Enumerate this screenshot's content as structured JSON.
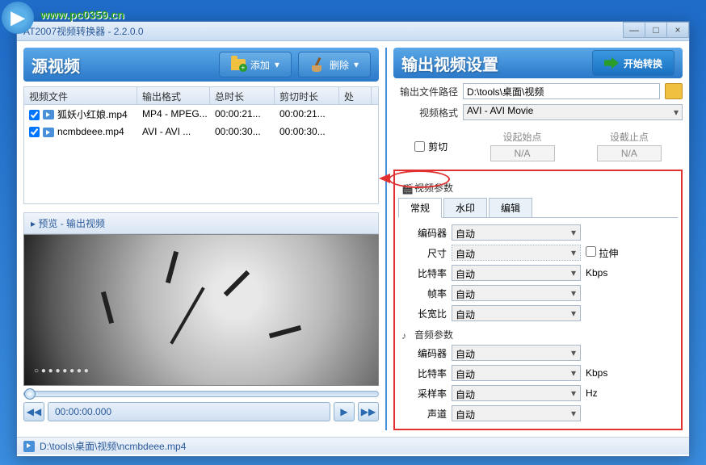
{
  "watermark": "www.pc0359.cn",
  "window": {
    "title": "AT2007视频转换器 - 2.2.0.0"
  },
  "left": {
    "title": "源视频",
    "add_btn": "添加",
    "del_btn": "删除",
    "columns": {
      "file": "视频文件",
      "fmt": "输出格式",
      "dur": "总时长",
      "cut": "剪切时长",
      "status": "处"
    },
    "rows": [
      {
        "name": "狐妖小红娘.mp4",
        "fmt": "MP4 - MPEG...",
        "dur": "00:00:21...",
        "cut": "00:00:21..."
      },
      {
        "name": "ncmbdeee.mp4",
        "fmt": "AVI - AVI ...",
        "dur": "00:00:30...",
        "cut": "00:00:30..."
      }
    ],
    "preview_title": "▸ 预览 - 输出视频",
    "timecode": "00:00:00.000"
  },
  "right": {
    "title": "输出视频设置",
    "start_btn": "开始转换",
    "out_path_label": "输出文件路径",
    "out_path": "D:\\tools\\桌面\\视频",
    "vid_fmt_label": "视频格式",
    "vid_fmt": "AVI - AVI Movie",
    "crop_label": "剪切",
    "set_start": "设起始点",
    "set_end": "设截止点",
    "na": "N/A",
    "video_params_title": "视频参数",
    "tabs": {
      "normal": "常规",
      "watermark": "水印",
      "edit": "编辑"
    },
    "video": {
      "encoder_label": "编码器",
      "encoder": "自动",
      "size_label": "尺寸",
      "size": "自动",
      "stretch": "拉伸",
      "bitrate_label": "比特率",
      "bitrate": "自动",
      "bitrate_unit": "Kbps",
      "fps_label": "帧率",
      "fps": "自动",
      "aspect_label": "长宽比",
      "aspect": "自动"
    },
    "audio_params_title": "音频参数",
    "audio": {
      "encoder_label": "编码器",
      "encoder": "自动",
      "bitrate_label": "比特率",
      "bitrate": "自动",
      "bitrate_unit": "Kbps",
      "sample_label": "采样率",
      "sample": "自动",
      "sample_unit": "Hz",
      "channel_label": "声道",
      "channel": "自动"
    }
  },
  "status": "D:\\tools\\桌面\\视频\\ncmbdeee.mp4"
}
